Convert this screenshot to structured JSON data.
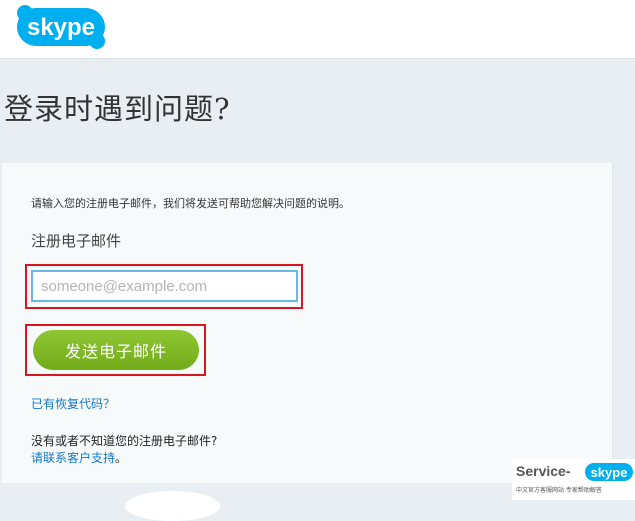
{
  "header": {
    "logo_text": "skype",
    "brand_color": "#00aff0"
  },
  "page": {
    "title": "登录时遇到问题?"
  },
  "form": {
    "instruction": "请输入您的注册电子邮件，我们将发送可帮助您解决问题的说明。",
    "email_label": "注册电子邮件",
    "email_placeholder": "someone@example.com",
    "email_value": "",
    "send_button_label": "发送电子邮件",
    "send_button_color": "#7cb726",
    "highlight_color": "#d9161f"
  },
  "links": {
    "recovery_code": "已有恢复代码？",
    "no_email_text": "没有或者不知道您的注册电子邮件?",
    "contact_support": "请联系客户支持",
    "contact_suffix": "。",
    "link_color": "#1478c8"
  },
  "watermark": {
    "service_text": "Service-",
    "logo_text": "skype",
    "small_text": "中文官方客服网站 专家帮助解答"
  }
}
